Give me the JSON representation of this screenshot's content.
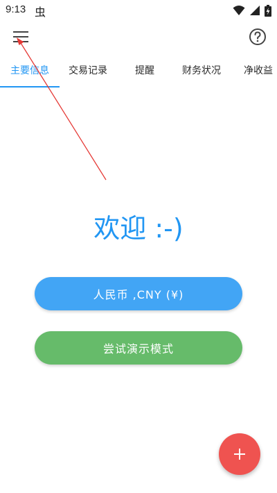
{
  "status_bar": {
    "time": "9:13",
    "notification_glyph": "虫",
    "icons": [
      "wifi-icon",
      "signal-icon",
      "battery-charging-icon"
    ]
  },
  "app_bar": {
    "menu_icon": "hamburger-menu-icon",
    "help_icon": "help-circle-icon"
  },
  "tabs": [
    {
      "label": "主要信息",
      "active": true
    },
    {
      "label": "交易记录",
      "active": false
    },
    {
      "label": "提醒",
      "active": false
    },
    {
      "label": "财务状况",
      "active": false
    },
    {
      "label": "净收益",
      "active": false
    }
  ],
  "main": {
    "welcome_text": "欢迎 :-)",
    "currency_button_label": "人民币 ,CNY (¥)",
    "demo_button_label": "尝试演示模式"
  },
  "fab": {
    "icon": "plus-icon"
  },
  "colors": {
    "accent": "#2196f3",
    "currency_button": "#42a5f5",
    "demo_button": "#66bb6a",
    "fab": "#ef5350",
    "annotation_arrow": "#e53935"
  }
}
